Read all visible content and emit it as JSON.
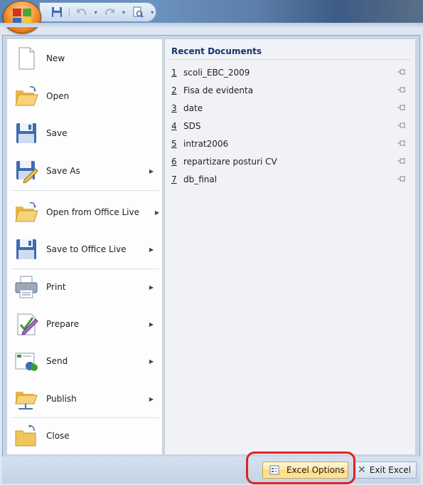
{
  "title_bar": {
    "qat": {
      "save_icon": "save-icon",
      "undo_icon": "undo-icon",
      "redo_icon": "redo-icon",
      "print_preview_icon": "print-preview-icon",
      "customize_icon": "customize-arrow-icon"
    },
    "colors": {
      "accent": "#4f7bb0",
      "orb": "#e07312",
      "highlight": "#e02222"
    }
  },
  "menu": {
    "items": [
      {
        "label": "New",
        "accel": "N",
        "icon": "new-document-icon",
        "submenu": false
      },
      {
        "label": "Open",
        "accel": "O",
        "icon": "open-folder-icon",
        "submenu": false
      },
      {
        "label": "Save",
        "accel": "S",
        "icon": "save-icon",
        "submenu": false
      },
      {
        "label": "Save As",
        "accel": "A",
        "icon": "save-as-icon",
        "submenu": true
      },
      {
        "label": "Open from Office Live",
        "icon": "open-office-live-icon",
        "submenu": true
      },
      {
        "label": "Save to Office Live",
        "icon": "save-office-live-icon",
        "submenu": true
      },
      {
        "label": "Print",
        "accel": "P",
        "icon": "print-icon",
        "submenu": true
      },
      {
        "label": "Prepare",
        "accel": "E",
        "icon": "prepare-icon",
        "submenu": true
      },
      {
        "label": "Send",
        "accel": "D",
        "icon": "send-icon",
        "submenu": true
      },
      {
        "label": "Publish",
        "accel": "U",
        "icon": "publish-icon",
        "submenu": true
      },
      {
        "label": "Close",
        "accel": "C",
        "icon": "close-folder-icon",
        "submenu": false
      }
    ]
  },
  "recent": {
    "title": "Recent Documents",
    "items": [
      {
        "num": "1",
        "name": "scoli_EBC_2009"
      },
      {
        "num": "2",
        "name": "Fisa de evidenta"
      },
      {
        "num": "3",
        "name": "date"
      },
      {
        "num": "4",
        "name": "SDS"
      },
      {
        "num": "5",
        "name": "intrat2006"
      },
      {
        "num": "6",
        "name": "repartizare posturi CV"
      },
      {
        "num": "7",
        "name": "db_final"
      }
    ]
  },
  "footer": {
    "options_label": "Excel Options",
    "exit_label": "Exit Excel"
  }
}
